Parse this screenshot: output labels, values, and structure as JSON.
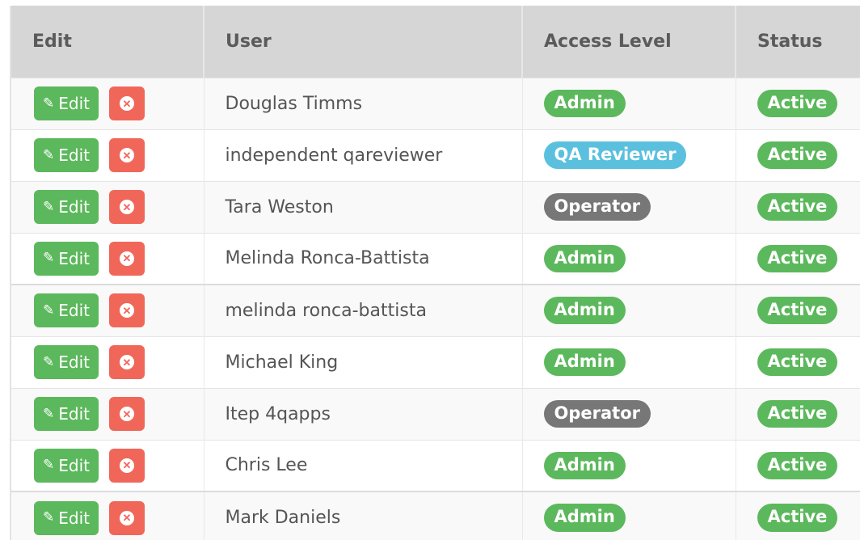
{
  "colors": {
    "header_bg": "#d6d6d6",
    "edit_button": "#5cb85c",
    "delete_button": "#f0675a",
    "badge_admin": "#5cb85c",
    "badge_qa_reviewer": "#5bc0de",
    "badge_operator": "#777777",
    "badge_active": "#5cb85c"
  },
  "table": {
    "headers": {
      "edit": "Edit",
      "user": "User",
      "access_level": "Access Level",
      "status": "Status"
    },
    "edit_button_label": "Edit",
    "edit_icon": "pencil-icon",
    "delete_icon": "close-circle-icon",
    "rows": [
      {
        "user": "Douglas Timms",
        "access": "Admin",
        "status": "Active"
      },
      {
        "user": "independent qareviewer",
        "access": "QA Reviewer",
        "status": "Active"
      },
      {
        "user": "Tara Weston",
        "access": "Operator",
        "status": "Active"
      },
      {
        "user": "Melinda Ronca-Battista",
        "access": "Admin",
        "status": "Active"
      },
      {
        "user": "melinda ronca-battista",
        "access": "Admin",
        "status": "Active"
      },
      {
        "user": "Michael King",
        "access": "Admin",
        "status": "Active"
      },
      {
        "user": "Itep 4qapps",
        "access": "Operator",
        "status": "Active"
      },
      {
        "user": "Chris Lee",
        "access": "Admin",
        "status": "Active"
      },
      {
        "user": "Mark Daniels",
        "access": "Admin",
        "status": "Active"
      }
    ]
  }
}
